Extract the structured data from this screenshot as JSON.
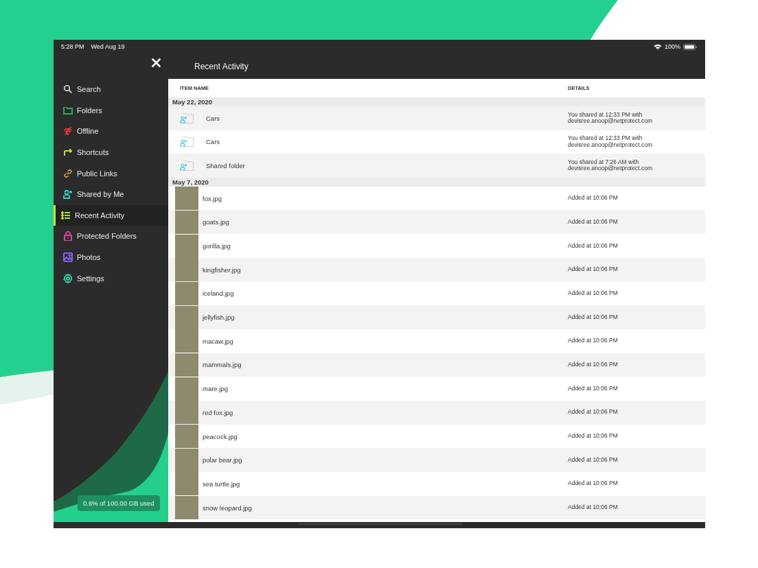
{
  "status_bar": {
    "time": "5:28 PM",
    "date": "Wed Aug 19",
    "battery": "100%"
  },
  "header": {
    "title": "Recent Activity"
  },
  "sidebar": {
    "items": [
      {
        "label": "Search",
        "kind": "search",
        "color": "#bdbdbd",
        "selected": false
      },
      {
        "label": "Folders",
        "kind": "folder",
        "color": "#27ae60",
        "selected": false
      },
      {
        "label": "Offline",
        "kind": "offline",
        "color": "#e53935",
        "selected": false
      },
      {
        "label": "Shortcuts",
        "kind": "shortcut",
        "color": "#c6d82a",
        "selected": false
      },
      {
        "label": "Public Links",
        "kind": "link",
        "color": "#e09a3a",
        "selected": false
      },
      {
        "label": "Shared by Me",
        "kind": "share",
        "color": "#2fd0c6",
        "selected": false
      },
      {
        "label": "Recent Activity",
        "kind": "list",
        "color": "#b5e03a",
        "selected": true
      },
      {
        "label": "Protected Folders",
        "kind": "lock",
        "color": "#d94aa8",
        "selected": false
      },
      {
        "label": "Photos",
        "kind": "photo",
        "color": "#8b5cf6",
        "selected": false
      },
      {
        "label": "Settings",
        "kind": "gear",
        "color": "#2fc9a0",
        "selected": false
      }
    ],
    "storage": "0.6% of 100.00 GB used"
  },
  "table": {
    "columns": [
      "ITEM NAME",
      "DETAILS"
    ],
    "groups": [
      {
        "date": "May 22, 2020",
        "rows": [
          {
            "kind": "shared-folder",
            "name": "Cars",
            "details": [
              "You shared at 12:33 PM with",
              "devisree.anoop@netprotect.com"
            ]
          },
          {
            "kind": "shared-folder",
            "name": "Cars",
            "details": [
              "You shared at 12:33 PM with",
              "devisree.anoop@netprotect.com"
            ]
          },
          {
            "kind": "shared-folder",
            "name": "Shared folder",
            "details": [
              "You shared at 7:26 AM with",
              "devisree.anoop@netprotect.com"
            ]
          }
        ]
      },
      {
        "date": "May 7, 2020",
        "rows": [
          {
            "kind": "photo",
            "name": "fox.jpg",
            "details": [
              "Added at 10:06 PM"
            ]
          },
          {
            "kind": "photo",
            "name": "goats.jpg",
            "details": [
              "Added at 10:06 PM"
            ]
          },
          {
            "kind": "photo",
            "name": "gorilla.jpg",
            "details": [
              "Added at 10:06 PM"
            ]
          },
          {
            "kind": "photo",
            "name": "kingfisher.jpg",
            "details": [
              "Added at 10:06 PM"
            ]
          },
          {
            "kind": "photo",
            "name": "iceland.jpg",
            "details": [
              "Added at 10:06 PM"
            ]
          },
          {
            "kind": "photo",
            "name": "jellyfish.jpg",
            "details": [
              "Added at 10:06 PM"
            ]
          },
          {
            "kind": "photo",
            "name": "macaw.jpg",
            "details": [
              "Added at 10:06 PM"
            ]
          },
          {
            "kind": "photo",
            "name": "mammals.jpg",
            "details": [
              "Added at 10:06 PM"
            ]
          },
          {
            "kind": "photo",
            "name": "mare.jpg",
            "details": [
              "Added at 10:06 PM"
            ]
          },
          {
            "kind": "photo",
            "name": "red fox.jpg",
            "details": [
              "Added at 10:06 PM"
            ]
          },
          {
            "kind": "photo",
            "name": "peacock.jpg",
            "details": [
              "Added at 10:06 PM"
            ]
          },
          {
            "kind": "photo",
            "name": "polar bear.jpg",
            "details": [
              "Added at 10:06 PM"
            ]
          },
          {
            "kind": "photo",
            "name": "sea turtle.jpg",
            "details": [
              "Added at 10:06 PM"
            ]
          },
          {
            "kind": "photo",
            "name": "snow leopard.jpg",
            "details": [
              "Added at 10:06 PM"
            ]
          }
        ]
      }
    ]
  }
}
